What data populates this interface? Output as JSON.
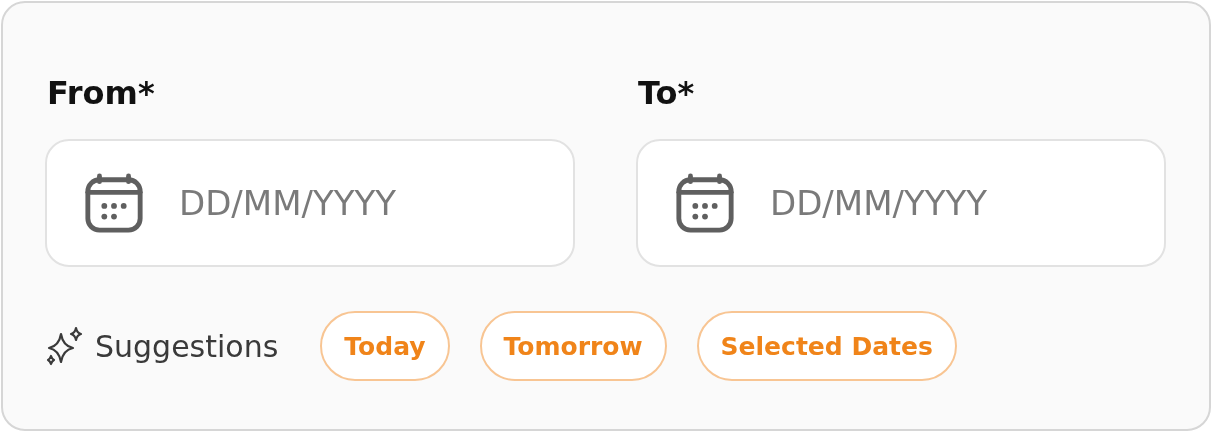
{
  "fields": [
    {
      "label": "From*",
      "placeholder": "DD/MM/YYYY"
    },
    {
      "label": "To*",
      "placeholder": "DD/MM/YYYY"
    }
  ],
  "suggestions": {
    "label": "Suggestions",
    "chips": [
      "Today",
      "Tomorrow",
      "Selected Dates"
    ]
  }
}
